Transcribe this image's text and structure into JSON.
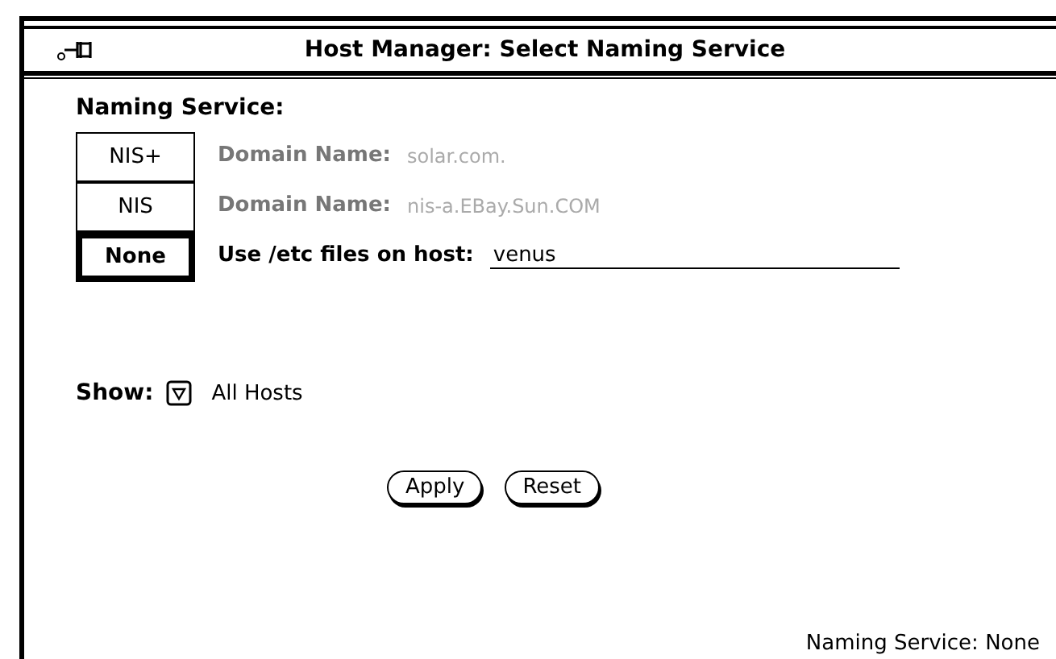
{
  "window": {
    "title": "Host Manager: Select Naming Service"
  },
  "naming_service": {
    "label": "Naming Service:",
    "options": [
      {
        "label": "NIS+",
        "selected": false,
        "kind": "text",
        "field_label": "Domain Name:",
        "value": "solar.com.",
        "disabled": true
      },
      {
        "label": "NIS",
        "selected": false,
        "kind": "text",
        "field_label": "Domain Name:",
        "value": "nis-a.EBay.Sun.COM",
        "disabled": true
      },
      {
        "label": "None",
        "selected": true,
        "kind": "input",
        "field_label": "Use /etc files on host:",
        "value": "venus",
        "disabled": false
      }
    ]
  },
  "show": {
    "label": "Show:",
    "value": "All Hosts"
  },
  "buttons": [
    "Apply",
    "Reset"
  ],
  "status_bar": "Naming Service: None"
}
